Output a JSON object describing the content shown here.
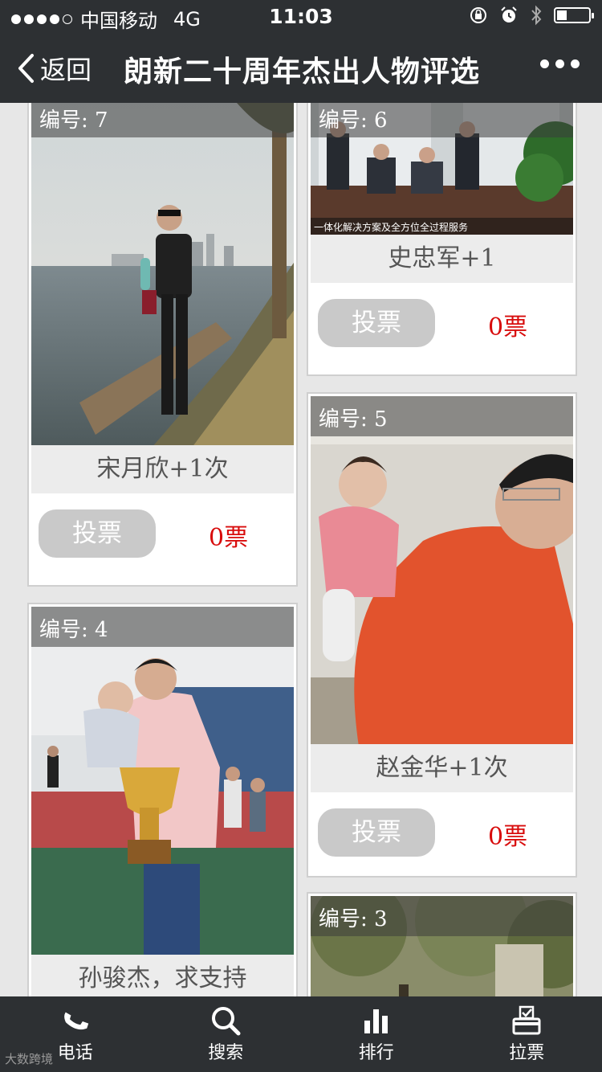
{
  "status": {
    "carrier": "中国移动",
    "network": "4G",
    "time": "11:03",
    "battery_level": 0.32
  },
  "nav": {
    "back_label": "返回",
    "title": "朗新二十周年杰出人物评选"
  },
  "cards": [
    {
      "badge": "编号: 7",
      "caption": "宋月欣+1次",
      "vote_label": "投票",
      "votes": "0票"
    },
    {
      "badge": "编号: 6",
      "caption": "史忠军+1",
      "vote_label": "投票",
      "votes": "0票",
      "banner": "一体化解决方案及全方位全过程服务"
    },
    {
      "badge": "编号: 5",
      "caption": "赵金华+1次",
      "vote_label": "投票",
      "votes": "0票"
    },
    {
      "badge": "编号: 4",
      "caption": "孙骏杰，求支持"
    },
    {
      "badge": "编号: 3"
    }
  ],
  "tabs": [
    {
      "label": "电话",
      "icon": "phone-icon"
    },
    {
      "label": "搜索",
      "icon": "search-icon"
    },
    {
      "label": "排行",
      "icon": "bar-chart-icon"
    },
    {
      "label": "拉票",
      "icon": "ballot-box-icon"
    }
  ],
  "watermark": "大数跨境"
}
